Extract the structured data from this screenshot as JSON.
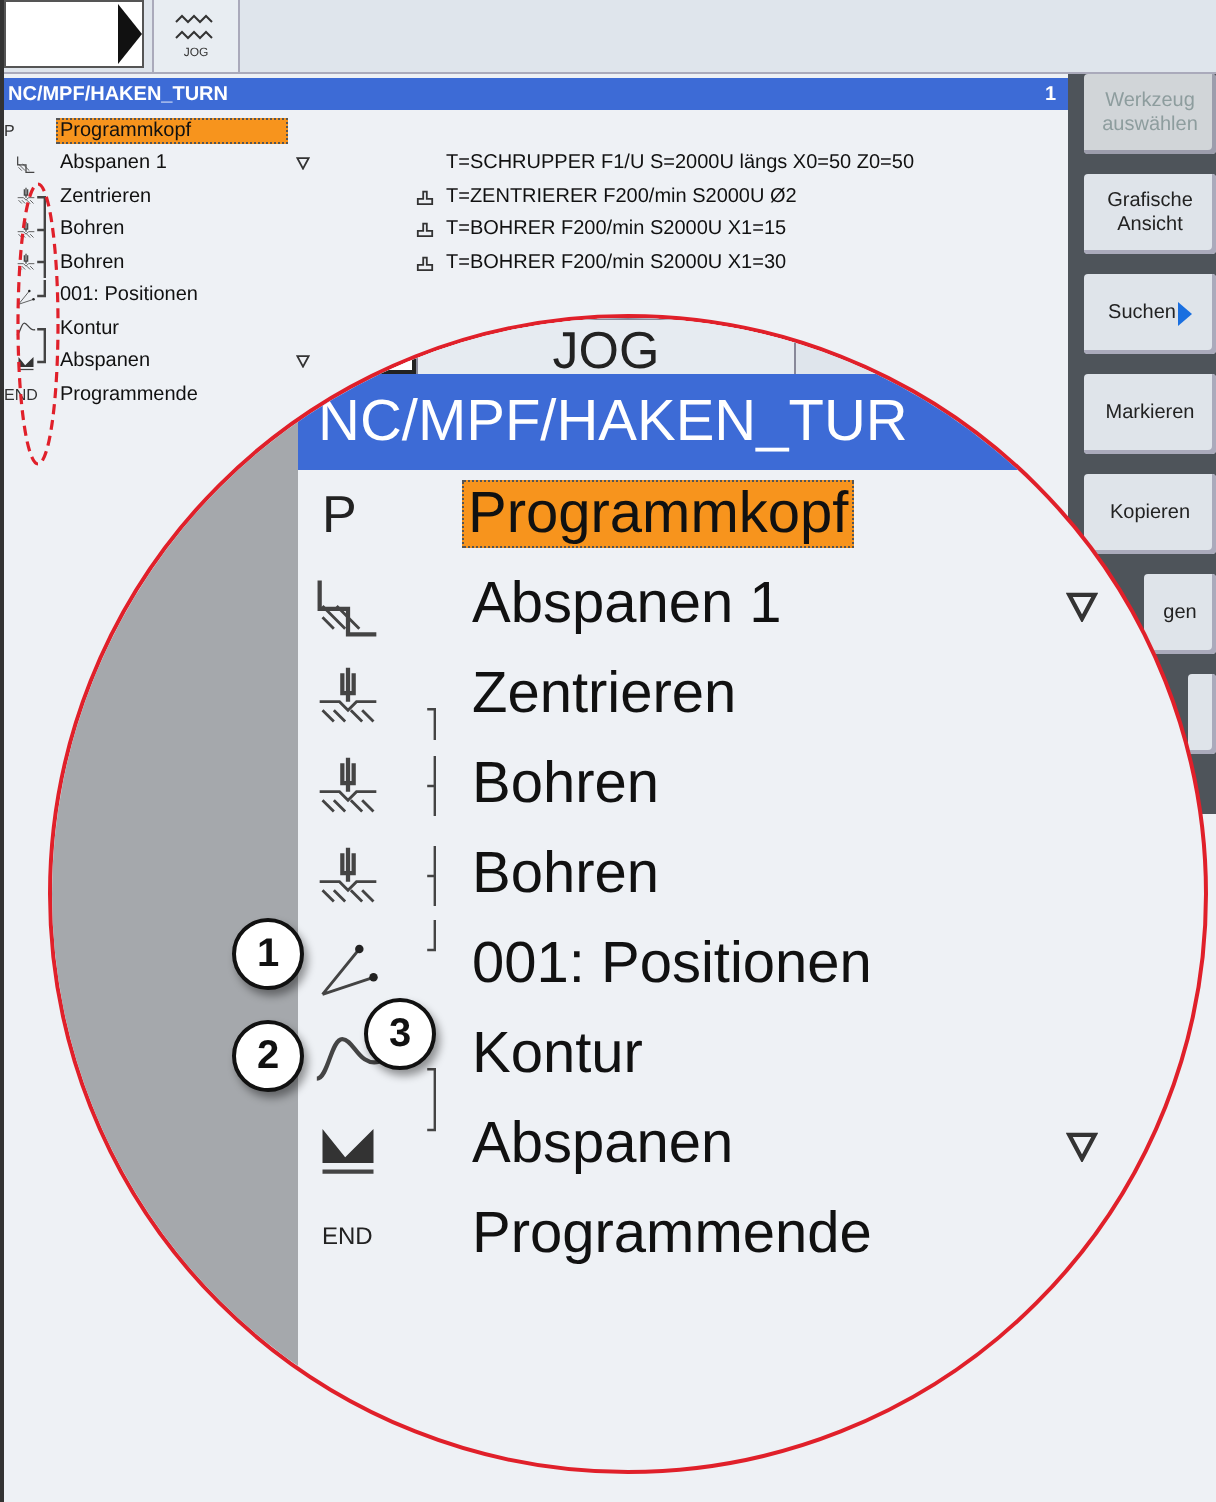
{
  "header": {
    "mode_label": "JOG"
  },
  "program": {
    "path": "NC/MPF/HAKEN_TURN",
    "number": "1"
  },
  "blocks": [
    {
      "kind": "header",
      "mark": "P",
      "name": "Programmkopf",
      "selected": true,
      "line_above": false,
      "line_below": false,
      "expandable": false,
      "tool": false
    },
    {
      "kind": "stock_removal",
      "name": "Abspanen 1",
      "selected": false,
      "line_above": false,
      "line_below": false,
      "expandable": true,
      "tool": false,
      "detail": "T=SCHRUPPER F1/U S=2000U längs X0=50 Z0=50"
    },
    {
      "kind": "centering",
      "name": "Zentrieren",
      "selected": false,
      "line_above": false,
      "line_below": true,
      "expandable": false,
      "tool": true,
      "detail": "T=ZENTRIERER F200/min S2000U Ø2"
    },
    {
      "kind": "drilling",
      "name": "Bohren",
      "selected": false,
      "line_above": true,
      "line_below": true,
      "expandable": false,
      "tool": true,
      "detail": "T=BOHRER F200/min S2000U X1=15"
    },
    {
      "kind": "drilling",
      "name": "Bohren",
      "selected": false,
      "line_above": true,
      "line_below": true,
      "expandable": false,
      "tool": true,
      "detail": "T=BOHRER F200/min S2000U X1=30"
    },
    {
      "kind": "positions",
      "name": "001: Positionen",
      "selected": false,
      "line_above": true,
      "line_below": false,
      "expandable": false,
      "tool": false
    },
    {
      "kind": "contour",
      "name": "Kontur",
      "selected": false,
      "line_above": false,
      "line_below": true,
      "expandable": false,
      "tool": false
    },
    {
      "kind": "contour_removal",
      "name": "Abspanen",
      "selected": false,
      "line_above": true,
      "line_below": false,
      "expandable": true,
      "tool": false
    },
    {
      "kind": "end",
      "mark": "END",
      "name": "Programmende",
      "selected": false,
      "line_above": false,
      "line_below": false,
      "expandable": false,
      "tool": false
    }
  ],
  "softkeys": [
    {
      "label": "Werkzeug auswählen",
      "disabled": true,
      "arrow": false
    },
    {
      "label": "Grafische Ansicht",
      "disabled": false,
      "arrow": false
    },
    {
      "label": "Suchen",
      "disabled": false,
      "arrow": true
    },
    {
      "label": "Markieren",
      "disabled": false,
      "arrow": false
    },
    {
      "label": "Kopieren",
      "disabled": false,
      "arrow": false
    },
    {
      "label": "gen",
      "disabled": false,
      "arrow": false
    },
    {
      "disabled": false,
      "arrow": false
    }
  ],
  "magnifier": {
    "tab": "JOG",
    "path": "NC/MPF/HAKEN_TUR",
    "blocks": [
      {
        "kind": "header",
        "mark": "P",
        "name": "Programmkopf",
        "selected": true,
        "line_above": false,
        "line_below": false,
        "expandable": false
      },
      {
        "kind": "stock_removal",
        "name": "Abspanen 1",
        "selected": false,
        "line_above": false,
        "line_below": false,
        "expandable": true
      },
      {
        "kind": "centering",
        "name": "Zentrieren",
        "selected": false,
        "line_above": false,
        "line_below": true,
        "expandable": false
      },
      {
        "kind": "drilling",
        "name": "Bohren",
        "selected": false,
        "line_above": true,
        "line_below": true,
        "expandable": false
      },
      {
        "kind": "drilling",
        "name": "Bohren",
        "selected": false,
        "line_above": true,
        "line_below": true,
        "expandable": false
      },
      {
        "kind": "positions",
        "name": "001: Positionen",
        "selected": false,
        "line_above": true,
        "line_below": false,
        "expandable": false
      },
      {
        "kind": "contour",
        "name": "Kontur",
        "selected": false,
        "line_above": false,
        "line_below": true,
        "expandable": false
      },
      {
        "kind": "contour_removal",
        "name": "Abspanen",
        "selected": false,
        "line_above": true,
        "line_below": false,
        "expandable": true
      },
      {
        "kind": "end",
        "mark": "END",
        "name": "Programmende",
        "selected": false,
        "line_above": false,
        "line_below": false,
        "expandable": false
      }
    ],
    "callouts": [
      "1",
      "2",
      "3"
    ]
  }
}
